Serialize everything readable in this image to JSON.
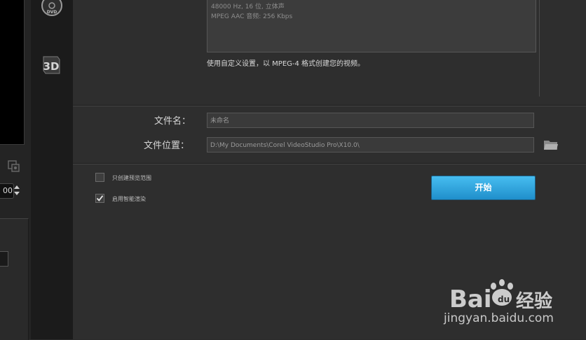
{
  "left_panel": {
    "timecode_fragment": "00"
  },
  "icon_rail": {
    "icons": [
      "dvd-disc-icon",
      "three-d-icon"
    ],
    "dvd_label": "DVD",
    "three_d_label": "3D"
  },
  "output_info": {
    "lines": [
      "48000 Hz, 16 位, 立体声",
      "MPEG AAC 音频: 256 Kbps"
    ],
    "custom_hint": "使用自定义设置，以 MPEG-4 格式创建您的视频。"
  },
  "file": {
    "name_label": "文件名：",
    "name_value": "未命名",
    "location_label": "文件位置：",
    "location_value": "D:\\My Documents\\Corel VideoStudio Pro\\X10.0\\"
  },
  "options": {
    "preview_range_label": "只创建预览范围",
    "preview_range_checked": false,
    "smart_render_label": "启用智能渲染",
    "smart_render_checked": true
  },
  "actions": {
    "start_label": "开始"
  },
  "watermark": {
    "logo_text": "Bai",
    "logo_text2": "经验",
    "url": "jingyan.baidu.com"
  },
  "colors": {
    "accent": "#2a9fd6",
    "panel_bg": "#2e2e2e",
    "rail_bg": "#1b1b1b"
  }
}
